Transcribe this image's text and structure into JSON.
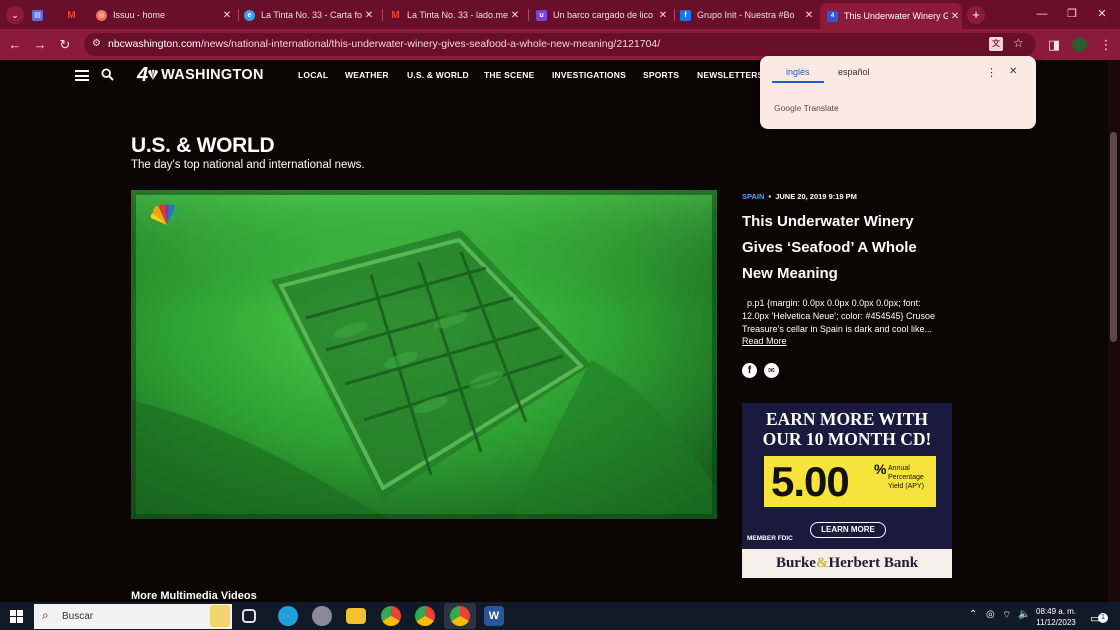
{
  "browser": {
    "tabs": [
      {
        "title": "",
        "favicon": "tab-overview-icon",
        "color": "#5b6ee1"
      },
      {
        "title": "",
        "favicon": "gmail-icon",
        "color": "#ea4335"
      },
      {
        "title": "Issuu - home",
        "favicon": "issuu-icon",
        "color": "#f36d5d"
      },
      {
        "title": "La Tinta No. 33 - Carta fo",
        "favicon": "edge-icon",
        "color": "#3aa0e8"
      },
      {
        "title": "La Tinta No. 33 - lado.me",
        "favicon": "gmail-icon",
        "color": "#ea4335"
      },
      {
        "title": "Un barco cargado de lico",
        "favicon": "univision-icon",
        "color": "#7b3fe4"
      },
      {
        "title": "Grupo Init - Nuestra #Bo",
        "favicon": "facebook-icon",
        "color": "#1877f2"
      },
      {
        "title": "This Underwater Winery G",
        "favicon": "nbc-icon",
        "color": "#2a5ad8"
      }
    ],
    "new_tab": "+",
    "url_host": "nbcwashington.com",
    "url_path": "/news/national-international/this-underwater-winery-gives-seafood-a-whole-new-meaning/2121704/"
  },
  "site": {
    "logo_number": "4",
    "logo_text": "WASHINGTON",
    "nav": [
      "LOCAL",
      "WEATHER",
      "U.S. & WORLD",
      "THE SCENE",
      "INVESTIGATIONS",
      "SPORTS",
      "NEWSLETTERS"
    ]
  },
  "translate": {
    "lang_from": "inglés",
    "lang_to": "español",
    "brand_google": "Google",
    "brand_translate": "Translate"
  },
  "section": {
    "title": "U.S. & WORLD",
    "subtitle": "The day's top national and international news."
  },
  "article": {
    "category": "SPAIN",
    "separator": "•",
    "date": "JUNE 20, 2019 9:19 PM",
    "headline_lines": [
      "This Underwater Winery",
      "Gives ‘Seafood’ A Whole",
      "New Meaning"
    ],
    "summary_lines": [
      "p.p1 {margin: 0.0px 0.0px 0.0px 0.0px; font:",
      "12.0px 'Helvetica Neue'; color: #454545} Crusoe",
      "Treasure's cellar in Spain is dark and cool like..."
    ],
    "read_more": "Read More"
  },
  "more_videos": "More Multimedia Videos",
  "ad": {
    "headline_lines": [
      "EARN MORE WITH",
      "OUR 10 MONTH CD!"
    ],
    "rate": "5.00",
    "percent": "%",
    "apy_lines": [
      "Annual",
      "Percentage",
      "Yield (APY)"
    ],
    "cta": "LEARN MORE",
    "fdic": "MEMBER FDIC",
    "bank_first": "Burke",
    "bank_amp": "&",
    "bank_second": "Herbert Bank"
  },
  "taskbar": {
    "search_placeholder": "Buscar",
    "time": "08:49 a. m.",
    "date": "11/12/2023",
    "notifications": "1"
  },
  "colors": {
    "tab_strip": "#6a0f2b",
    "toolbar": "#8c1a3a",
    "page_bg": "#0b0506",
    "ad_yellow": "#f6e33c",
    "accent_blue": "#4da3ff"
  }
}
